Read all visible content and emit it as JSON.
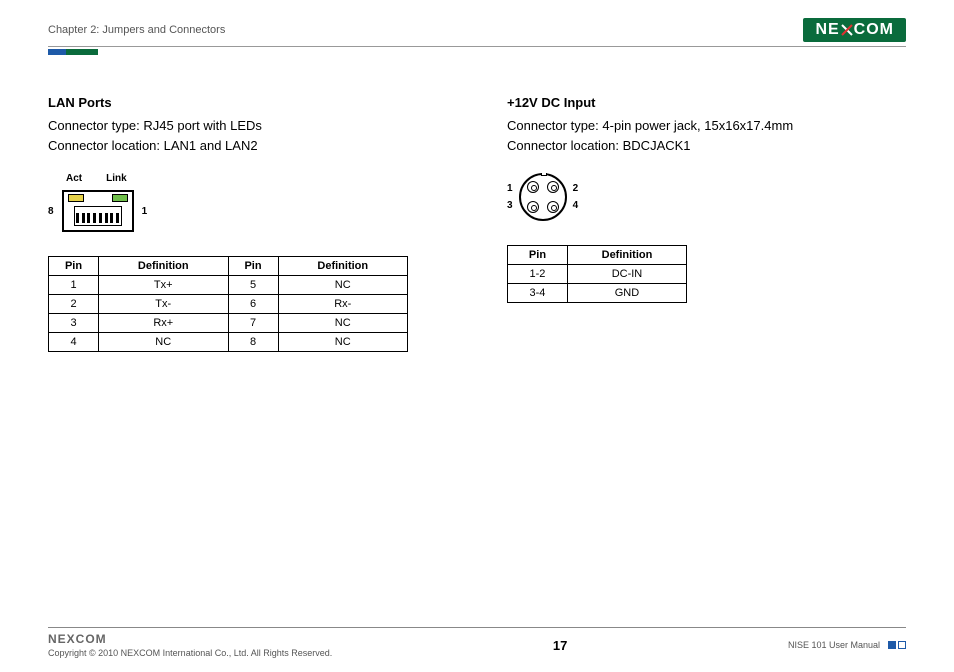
{
  "header": {
    "chapter": "Chapter 2: Jumpers and Connectors",
    "brand": "NEXCOM"
  },
  "lan": {
    "title": "LAN Ports",
    "line1": "Connector type: RJ45 port with LEDs",
    "line2": "Connector location: LAN1 and LAN2",
    "act": "Act",
    "link": "Link",
    "left_pin": "8",
    "right_pin": "1",
    "table": {
      "h_pin": "Pin",
      "h_def": "Definition",
      "rows": [
        {
          "p1": "1",
          "d1": "Tx+",
          "p2": "5",
          "d2": "NC"
        },
        {
          "p1": "2",
          "d1": "Tx-",
          "p2": "6",
          "d2": "Rx-"
        },
        {
          "p1": "3",
          "d1": "Rx+",
          "p2": "7",
          "d2": "NC"
        },
        {
          "p1": "4",
          "d1": "NC",
          "p2": "8",
          "d2": "NC"
        }
      ]
    }
  },
  "dc": {
    "title": "+12V DC Input",
    "line1": "Connector type: 4-pin power jack, 15x16x17.4mm",
    "line2": "Connector location: BDCJACK1",
    "n1": "1",
    "n2": "2",
    "n3": "3",
    "n4": "4",
    "table": {
      "h_pin": "Pin",
      "h_def": "Definition",
      "rows": [
        {
          "p": "1-2",
          "d": "DC-IN"
        },
        {
          "p": "3-4",
          "d": "GND"
        }
      ]
    }
  },
  "footer": {
    "brand": "NEXCOM",
    "copyright": "Copyright © 2010 NEXCOM International Co., Ltd. All Rights Reserved.",
    "page": "17",
    "doc": "NISE 101 User Manual"
  }
}
